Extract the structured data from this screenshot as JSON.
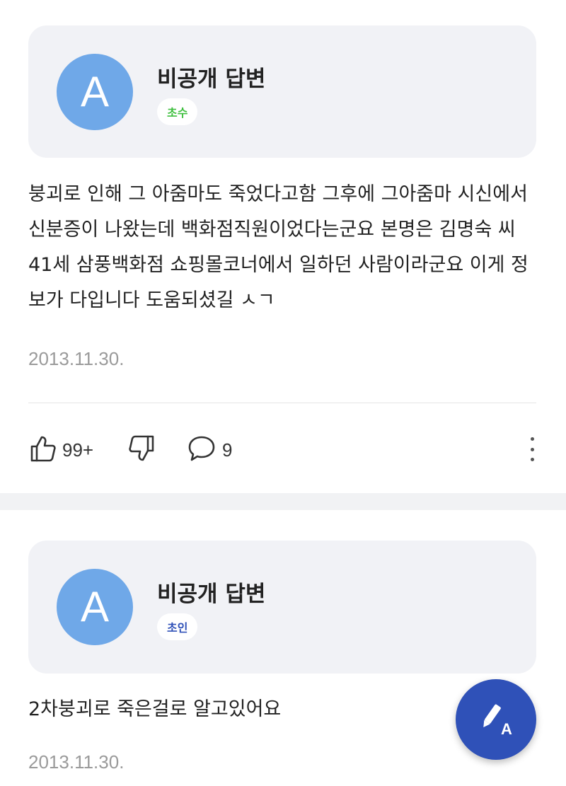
{
  "answers": [
    {
      "avatar_letter": "A",
      "author": "비공개 답변",
      "badge": "초수",
      "badge_color": "#3fbf3f",
      "body": "붕괴로 인해 그 아줌마도 죽었다고함 그후에 그아줌마 시신에서 신분증이 나왔는데 백화점직원이었다는군요 본명은 김명숙 씨 41세 삼풍백화점 쇼핑몰코너에서 일하던 사람이라군요 이게 정보가 다입니다 도움되셨길 ㅅㄱ",
      "date": "2013.11.30.",
      "likes": "99+",
      "comments": "9"
    },
    {
      "avatar_letter": "A",
      "author": "비공개 답변",
      "badge": "초인",
      "badge_color": "#2f51b8",
      "body": "2차붕괴로 죽은걸로 알고있어요",
      "date": "2013.11.30."
    }
  ],
  "icons": {
    "like": "thumbs-up-icon",
    "dislike": "thumbs-down-icon",
    "comment": "speech-bubble-icon",
    "more": "more-vertical-icon",
    "write": "pencil-icon"
  },
  "fab": {
    "label": "A",
    "color": "#2f51b8"
  }
}
